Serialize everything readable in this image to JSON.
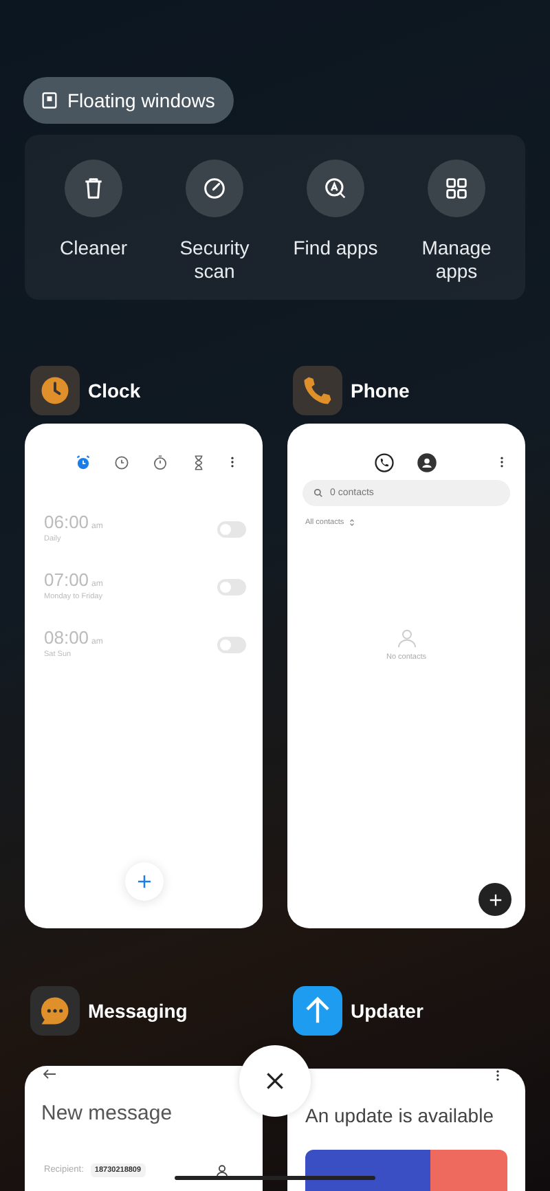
{
  "floating_windows": {
    "label": "Floating windows"
  },
  "shortcuts": [
    {
      "label": "Cleaner"
    },
    {
      "label": "Security scan"
    },
    {
      "label": "Find apps"
    },
    {
      "label": "Manage apps"
    }
  ],
  "apps": [
    {
      "kind": "clock",
      "name": "Clock",
      "tabs": [
        {
          "selected": true
        },
        {
          "selected": false
        },
        {
          "selected": false
        },
        {
          "selected": false
        }
      ],
      "alarms": [
        {
          "time": "06:00",
          "period": "am",
          "repeat": "Daily",
          "on": false
        },
        {
          "time": "07:00",
          "period": "am",
          "repeat": "Monday to Friday",
          "on": false
        },
        {
          "time": "08:00",
          "period": "am",
          "repeat": "Sat Sun",
          "on": false
        }
      ]
    },
    {
      "kind": "phone",
      "name": "Phone",
      "search": {
        "placeholder": "0 contacts"
      },
      "filter": "All contacts",
      "empty": "No contacts"
    },
    {
      "kind": "messaging",
      "name": "Messaging",
      "title": "New message",
      "recipient_label": "Recipient:",
      "recipient": "18730218809"
    },
    {
      "kind": "updater",
      "name": "Updater",
      "title": "An update is available"
    }
  ]
}
